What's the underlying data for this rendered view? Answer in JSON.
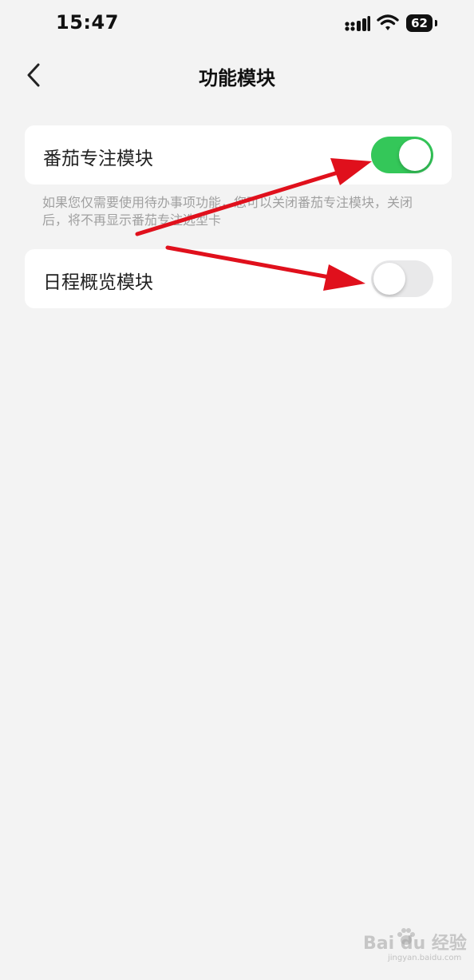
{
  "status_bar": {
    "time": "15:47",
    "battery": "62",
    "icons": [
      "signal-icon",
      "wifi-icon",
      "battery-icon"
    ]
  },
  "nav": {
    "back_icon": "chevron-left-icon",
    "title": "功能模块"
  },
  "modules": [
    {
      "label": "番茄专注模块",
      "enabled": true,
      "help": "如果您仅需要使用待办事项功能，您可以关闭番茄专注模块，关闭后，将不再显示番茄专注选型卡"
    },
    {
      "label": "日程概览模块",
      "enabled": false
    }
  ],
  "colors": {
    "background": "#f3f3f3",
    "card": "#ffffff",
    "toggle_on": "#34c759",
    "toggle_off": "#e9e9ea",
    "annotation_arrow": "#e0101c"
  },
  "watermark": {
    "text": "Bai du 经验",
    "sub": "jingyan.baidu.com"
  }
}
